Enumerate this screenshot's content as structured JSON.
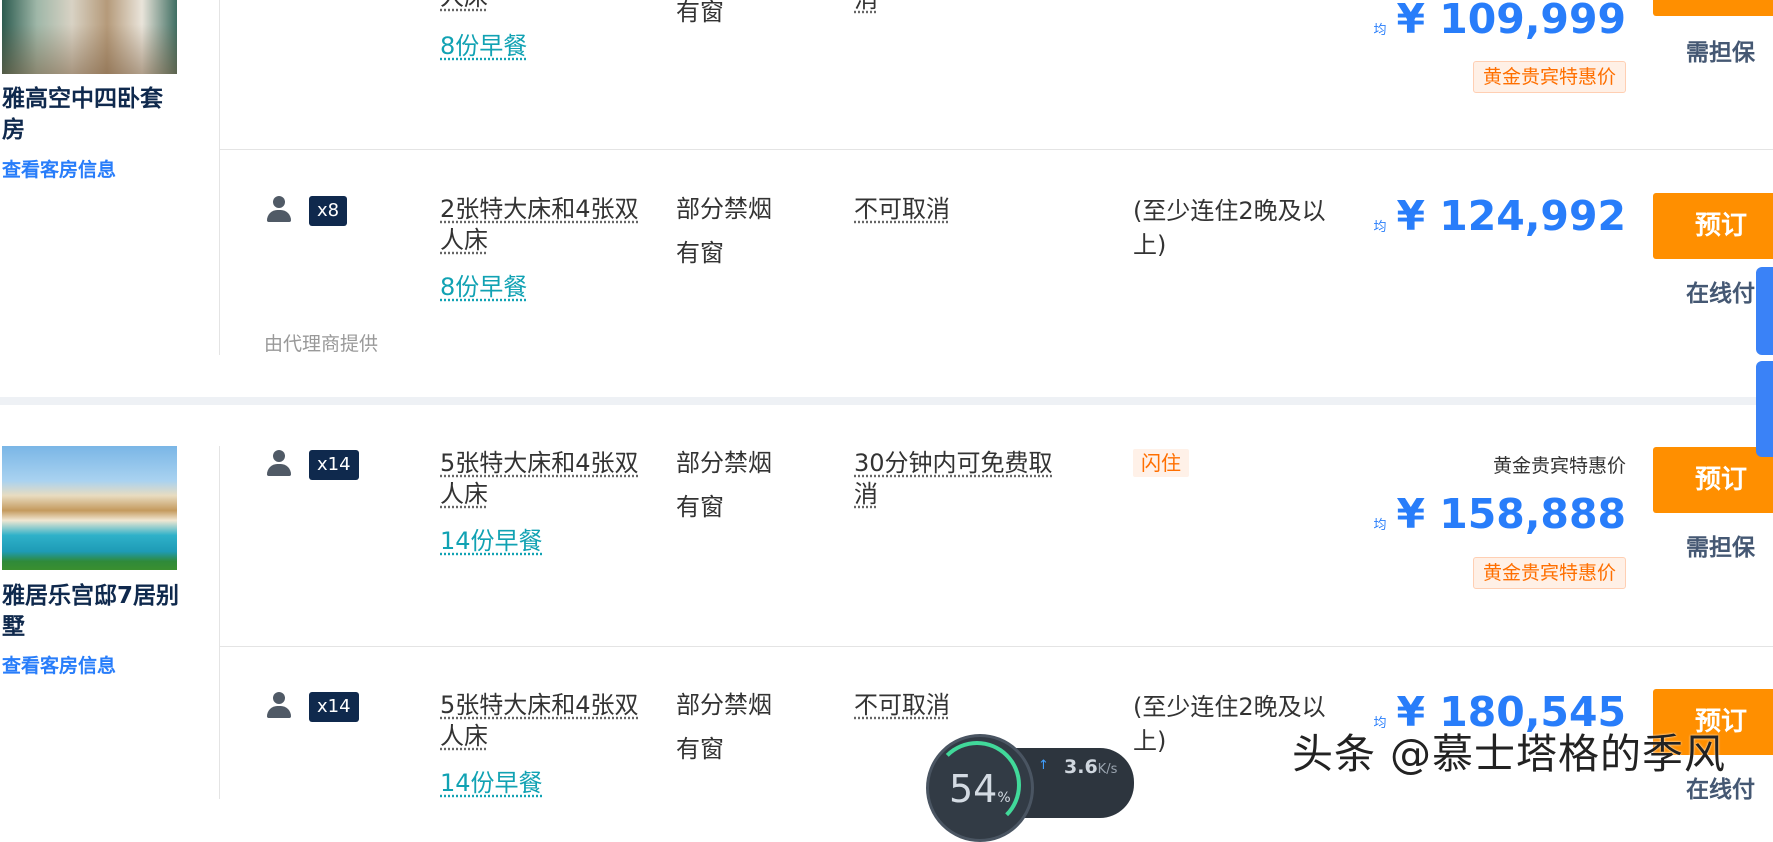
{
  "rooms": [
    {
      "name": "雅高空中四卧套房",
      "link": "查看客房信息",
      "offers": [
        {
          "guests": "",
          "bed": "人床",
          "breakfast": "8份早餐",
          "smoking": "",
          "window": "有窗",
          "cancel": "消",
          "note": "",
          "avg_label": "均",
          "price": "¥ 109,999",
          "vip_top": "",
          "vip_box": "黄金贵宾特惠价",
          "book": "",
          "payment": "需担保",
          "agent": ""
        },
        {
          "guests": "x8",
          "bed": "2张特大床和4张双人床",
          "breakfast": "8份早餐",
          "smoking": "部分禁烟",
          "window": "有窗",
          "cancel": "不可取消",
          "note": "(至少连住2晚及以上)",
          "avg_label": "均",
          "price": "¥ 124,992",
          "vip_top": "",
          "vip_box": "",
          "book": "预订",
          "payment": "在线付",
          "agent": "由代理商提供"
        }
      ]
    },
    {
      "name": "雅居乐宫邸7居别墅",
      "link": "查看客房信息",
      "offers": [
        {
          "guests": "x14",
          "bed": "5张特大床和4张双人床",
          "breakfast": "14份早餐",
          "smoking": "部分禁烟",
          "window": "有窗",
          "cancel": "30分钟内可免费取消",
          "tag": "闪住",
          "avg_label": "均",
          "price": "¥ 158,888",
          "vip_top": "黄金贵宾特惠价",
          "vip_box": "黄金贵宾特惠价",
          "book": "预订",
          "payment": "需担保"
        },
        {
          "guests": "x14",
          "bed": "5张特大床和4张双人床",
          "breakfast": "14份早餐",
          "smoking": "部分禁烟",
          "window": "有窗",
          "cancel": "不可取消",
          "note": "(至少连住2晚及以上)",
          "avg_label": "均",
          "price": "¥ 180,545",
          "book": "预订",
          "payment": "在线付"
        }
      ]
    }
  ],
  "overlay": {
    "watermark": "头条 @慕士塔格的季风",
    "speed_percent": "54",
    "speed_percent_unit": "%",
    "upload_rate": "3.6",
    "upload_unit": "K/s",
    "up_arrow": "↑"
  },
  "colors": {
    "accent_blue": "#287dfa",
    "book_orange": "#ff8f00",
    "breakfast_teal": "#11a2b3",
    "navy": "#0f294d"
  }
}
